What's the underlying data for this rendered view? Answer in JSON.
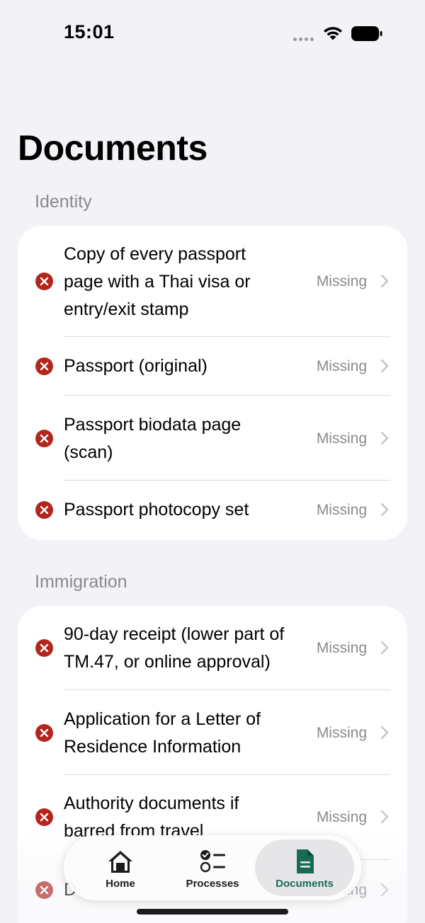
{
  "status_bar": {
    "time": "15:01"
  },
  "page": {
    "title": "Documents"
  },
  "sections": [
    {
      "header": "Identity",
      "items": [
        {
          "label": "Copy of every passport page with a Thai visa or entry/exit stamp",
          "status": "Missing"
        },
        {
          "label": "Passport (original)",
          "status": "Missing"
        },
        {
          "label": "Passport biodata page (scan)",
          "status": "Missing"
        },
        {
          "label": "Passport photocopy set",
          "status": "Missing"
        }
      ]
    },
    {
      "header": "Immigration",
      "items": [
        {
          "label": "90-day receipt (lower part of TM.47, or online approval)",
          "status": "Missing"
        },
        {
          "label": "Application for a Letter of Residence Information",
          "status": "Missing"
        },
        {
          "label": "Authority documents if barred from travel",
          "status": "Missing"
        },
        {
          "label": "D",
          "status": "Missing"
        }
      ]
    }
  ],
  "tab_bar": {
    "tabs": [
      {
        "label": "Home",
        "icon": "house-icon"
      },
      {
        "label": "Processes",
        "icon": "checklist-icon"
      },
      {
        "label": "Documents",
        "icon": "document-icon",
        "active": true
      }
    ]
  },
  "colors": {
    "background": "#f2f2f7",
    "missing_icon": "#b3261e",
    "active_tab": "#1a6b55",
    "secondary_text": "#8a8a8e"
  }
}
